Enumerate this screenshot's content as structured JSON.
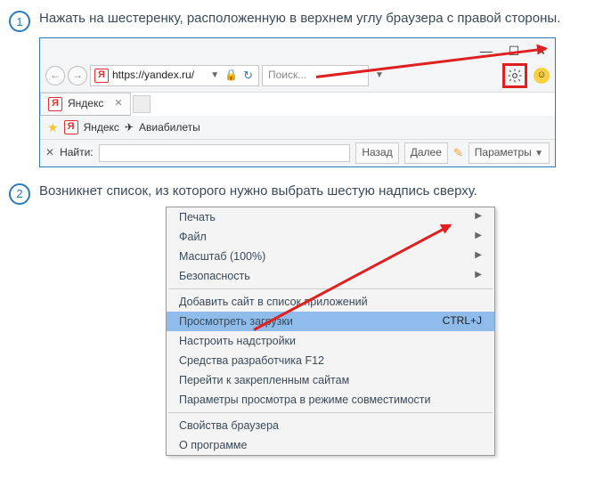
{
  "step1": {
    "num": "1",
    "text": "Нажать на шестеренку, расположенную в верхнем углу браузера с правой стороны."
  },
  "step2": {
    "num": "2",
    "text": "Возникнет список, из которого нужно выбрать шестую надпись сверху."
  },
  "browser": {
    "url": "https://yandex.ru/",
    "search_placeholder": "Поиск...",
    "tab_label": "Яндекс",
    "bookmarks": {
      "yandex": "Яндекс",
      "avia": "Авиабилеты"
    },
    "find": {
      "label": "Найти:",
      "back": "Назад",
      "next": "Далее",
      "params": "Параметры"
    }
  },
  "menu": {
    "print": "Печать",
    "file": "Файл",
    "zoom": "Масштаб (100%)",
    "security": "Безопасность",
    "add_site": "Добавить сайт в список приложений",
    "downloads": "Просмотреть загрузки",
    "downloads_shortcut": "CTRL+J",
    "manage_addons": "Настроить надстройки",
    "dev_tools": "Средства разработчика F12",
    "pinned": "Перейти к закрепленным сайтам",
    "compat": "Параметры просмотра в режиме совместимости",
    "props": "Свойства браузера",
    "about": "О программе"
  }
}
